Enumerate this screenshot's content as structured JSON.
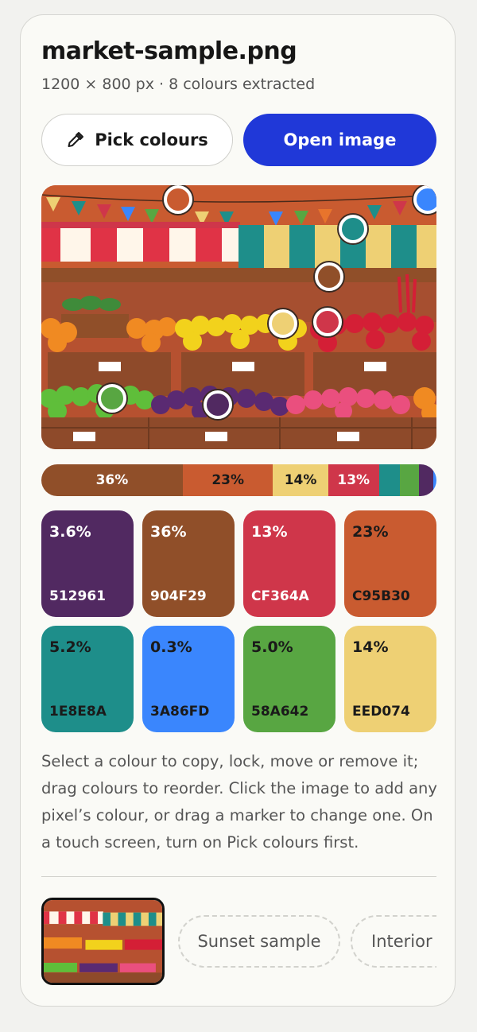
{
  "header": {
    "title": "market-sample.png",
    "subtitle": "1200 × 800 px · 8 colours extracted"
  },
  "buttons": {
    "pick_label": "Pick colours",
    "open_label": "Open image"
  },
  "ratio_bar": [
    {
      "hex": "#904F29",
      "share": 36,
      "label": "36%",
      "text_color": "#ffffff"
    },
    {
      "hex": "#C95B30",
      "share": 23,
      "label": "23%",
      "text_color": "#1a1a1a"
    },
    {
      "hex": "#EED074",
      "share": 14,
      "label": "14%",
      "text_color": "#1a1a1a"
    },
    {
      "hex": "#CF364A",
      "share": 13,
      "label": "13%",
      "text_color": "#ffffff"
    },
    {
      "hex": "#1E8E8A",
      "share": 5.2,
      "label": "",
      "text_color": "#ffffff"
    },
    {
      "hex": "#58A642",
      "share": 5.0,
      "label": "",
      "text_color": "#ffffff"
    },
    {
      "hex": "#512961",
      "share": 3.6,
      "label": "",
      "text_color": "#ffffff"
    },
    {
      "hex": "#3A86FD",
      "share": 0.3,
      "label": "",
      "text_color": "#ffffff"
    }
  ],
  "swatches": [
    {
      "percent": "3.6%",
      "hex_label": "512961",
      "color": "#512961",
      "text_color": "#ffffff"
    },
    {
      "percent": "36%",
      "hex_label": "904F29",
      "color": "#904F29",
      "text_color": "#ffffff"
    },
    {
      "percent": "13%",
      "hex_label": "CF364A",
      "color": "#CF364A",
      "text_color": "#ffffff"
    },
    {
      "percent": "23%",
      "hex_label": "C95B30",
      "color": "#C95B30",
      "text_color": "#1a1a1a"
    },
    {
      "percent": "5.2%",
      "hex_label": "1E8E8A",
      "color": "#1E8E8A",
      "text_color": "#1a1a1a"
    },
    {
      "percent": "0.3%",
      "hex_label": "3A86FD",
      "color": "#3A86FD",
      "text_color": "#1a1a1a"
    },
    {
      "percent": "5.0%",
      "hex_label": "58A642",
      "color": "#58A642",
      "text_color": "#1a1a1a"
    },
    {
      "percent": "14%",
      "hex_label": "EED074",
      "color": "#EED074",
      "text_color": "#1a1a1a"
    }
  ],
  "help_text": "Select a colour to copy, lock, move or remove it; drag colours to reorder. Click the image to add any pixel’s colour, or drag a marker to change one. On a touch screen, turn on Pick colours first.",
  "samples": {
    "sunset_label": "Sunset sample",
    "interior_label": "Interior"
  },
  "icons": {
    "pick_button": "eyedropper-icon"
  }
}
